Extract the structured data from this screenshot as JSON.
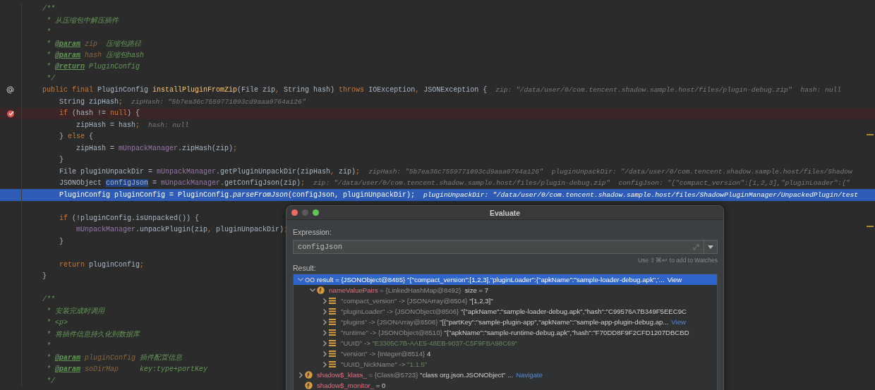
{
  "editor": {
    "lines": [
      {
        "kind": "code",
        "segments": [
          {
            "kind": "doc",
            "text": "/**"
          }
        ]
      },
      {
        "kind": "code",
        "segments": [
          {
            "kind": "doc",
            "text": " * 从压缩包中解压插件"
          }
        ]
      },
      {
        "kind": "code",
        "segments": [
          {
            "kind": "doc",
            "text": " *"
          }
        ]
      },
      {
        "kind": "code",
        "segments": [
          {
            "kind": "doc",
            "text": " * "
          },
          {
            "kind": "tag",
            "text": "@param"
          },
          {
            "kind": "param",
            "text": " zip"
          },
          {
            "kind": "doc",
            "text": "  压缩包路径"
          }
        ]
      },
      {
        "kind": "code",
        "segments": [
          {
            "kind": "doc",
            "text": " * "
          },
          {
            "kind": "tag",
            "text": "@param"
          },
          {
            "kind": "param",
            "text": " hash"
          },
          {
            "kind": "doc",
            "text": " 压缩包hash"
          }
        ]
      },
      {
        "kind": "code",
        "segments": [
          {
            "kind": "doc",
            "text": " * "
          },
          {
            "kind": "tag",
            "text": "@return"
          },
          {
            "kind": "doc",
            "text": " PluginConfig"
          }
        ]
      },
      {
        "kind": "code",
        "segments": [
          {
            "kind": "doc",
            "text": " */"
          }
        ]
      },
      {
        "kind": "marked",
        "segments": [
          {
            "kind": "kw",
            "text": "public final "
          },
          {
            "kind": "plain",
            "text": "PluginConfig "
          },
          {
            "kind": "decl",
            "text": "installPluginFromZip"
          },
          {
            "kind": "plain",
            "text": "(File zip"
          },
          {
            "kind": "kw",
            "text": ", "
          },
          {
            "kind": "plain",
            "text": "String hash) "
          },
          {
            "kind": "kw",
            "text": "throws "
          },
          {
            "kind": "plain",
            "text": "IOException"
          },
          {
            "kind": "kw",
            "text": ", "
          },
          {
            "kind": "plain",
            "text": "JSONException {"
          }
        ],
        "hints": [
          "zip: \"/data/user/0/com.tencent.shadow.sample.host/files/plugin-debug.zip\"",
          "hash: null"
        ]
      },
      {
        "kind": "code",
        "segments": [
          {
            "kind": "plain",
            "text": "    String zipHash"
          },
          {
            "kind": "kw",
            "text": ";"
          }
        ],
        "hints": [
          "zipHash: \"5b7ea36c7559771093cd9aaa0764a126\""
        ]
      },
      {
        "kind": "breakpoint",
        "segments": [
          {
            "kind": "kw",
            "text": "    if "
          },
          {
            "kind": "plain",
            "text": "(hash != "
          },
          {
            "kind": "kw",
            "text": "null"
          },
          {
            "kind": "plain",
            "text": ") {"
          }
        ]
      },
      {
        "kind": "code",
        "segments": [
          {
            "kind": "plain",
            "text": "        zipHash = hash"
          },
          {
            "kind": "kw",
            "text": ";"
          }
        ],
        "hints": [
          "hash: null"
        ]
      },
      {
        "kind": "code",
        "segments": [
          {
            "kind": "plain",
            "text": "    } "
          },
          {
            "kind": "kw",
            "text": "else "
          },
          {
            "kind": "plain",
            "text": "{"
          }
        ]
      },
      {
        "kind": "code",
        "segments": [
          {
            "kind": "plain",
            "text": "        zipHash = "
          },
          {
            "kind": "field",
            "text": "mUnpackManager"
          },
          {
            "kind": "plain",
            "text": ".zipHash(zip)"
          },
          {
            "kind": "kw",
            "text": ";"
          }
        ]
      },
      {
        "kind": "code",
        "segments": [
          {
            "kind": "plain",
            "text": "    }"
          }
        ]
      },
      {
        "kind": "code",
        "segments": [
          {
            "kind": "plain",
            "text": "    File pluginUnpackDir = "
          },
          {
            "kind": "field",
            "text": "mUnpackManager"
          },
          {
            "kind": "plain",
            "text": ".getPluginUnpackDir(zipHash"
          },
          {
            "kind": "kw",
            "text": ", "
          },
          {
            "kind": "plain",
            "text": "zip)"
          },
          {
            "kind": "kw",
            "text": ";"
          }
        ],
        "hints": [
          "zipHash: \"5b7ea36c7559771093cd9aaa0764a126\"",
          "pluginUnpackDir: \"/data/user/0/com.tencent.shadow.sample.host/files/Shadow"
        ]
      },
      {
        "kind": "code",
        "segments": [
          {
            "kind": "plain",
            "text": "    JSONObject "
          },
          {
            "kind": "sel",
            "text": "configJson"
          },
          {
            "kind": "plain",
            "text": " = "
          },
          {
            "kind": "field",
            "text": "mUnpackManager"
          },
          {
            "kind": "plain",
            "text": ".getConfigJson(zip)"
          },
          {
            "kind": "kw",
            "text": ";"
          }
        ],
        "hints": [
          "zip: \"/data/user/0/com.tencent.shadow.sample.host/files/plugin-debug.zip\"",
          "configJson: \"{\"compact_version\":[1,2,3],\"pluginLoader\":{\""
        ]
      },
      {
        "kind": "execution",
        "segments": [
          {
            "kind": "plain",
            "text": "    PluginConfig pluginConfig = PluginConfig."
          },
          {
            "kind": "static",
            "text": "parseFromJson"
          },
          {
            "kind": "plain",
            "text": "(configJson, pluginUnpackDir);"
          }
        ],
        "hints": [
          "pluginUnpackDir: \"/data/user/0/com.tencent.shadow.sample.host/files/ShadowPluginManager/UnpackedPlugin/test"
        ]
      },
      {
        "kind": "blank"
      },
      {
        "kind": "code",
        "segments": [
          {
            "kind": "kw",
            "text": "    if "
          },
          {
            "kind": "plain",
            "text": "(!pluginConfig.isUnpacked()) {"
          }
        ]
      },
      {
        "kind": "code",
        "segments": [
          {
            "kind": "field",
            "text": "        mUnpackManager"
          },
          {
            "kind": "plain",
            "text": ".unpackPlugin(zip"
          },
          {
            "kind": "kw",
            "text": ", "
          },
          {
            "kind": "plain",
            "text": "pluginUnpackDir)"
          },
          {
            "kind": "kw",
            "text": ";"
          }
        ]
      },
      {
        "kind": "code",
        "segments": [
          {
            "kind": "plain",
            "text": "    }"
          }
        ]
      },
      {
        "kind": "blank"
      },
      {
        "kind": "code",
        "segments": [
          {
            "kind": "kw",
            "text": "    return "
          },
          {
            "kind": "plain",
            "text": "pluginConfig"
          },
          {
            "kind": "kw",
            "text": ";"
          }
        ]
      },
      {
        "kind": "code",
        "segments": [
          {
            "kind": "plain",
            "text": "}"
          }
        ]
      },
      {
        "kind": "blank"
      },
      {
        "kind": "code",
        "segments": [
          {
            "kind": "doc",
            "text": "/**"
          }
        ]
      },
      {
        "kind": "code",
        "segments": [
          {
            "kind": "doc",
            "text": " * 安装完成时调用"
          }
        ]
      },
      {
        "kind": "code",
        "segments": [
          {
            "kind": "doc",
            "text": " * <p>"
          }
        ]
      },
      {
        "kind": "code",
        "segments": [
          {
            "kind": "doc",
            "text": " * 将插件信息持久化到数据库"
          }
        ]
      },
      {
        "kind": "code",
        "segments": [
          {
            "kind": "doc",
            "text": " *"
          }
        ]
      },
      {
        "kind": "code",
        "segments": [
          {
            "kind": "doc",
            "text": " * "
          },
          {
            "kind": "tag",
            "text": "@param"
          },
          {
            "kind": "param",
            "text": " pluginConfig"
          },
          {
            "kind": "doc",
            "text": " 插件配置信息"
          }
        ]
      },
      {
        "kind": "code",
        "segments": [
          {
            "kind": "doc",
            "text": " * "
          },
          {
            "kind": "tag",
            "text": "@param"
          },
          {
            "kind": "param",
            "text": " soDirMap"
          },
          {
            "kind": "doc",
            "text": "     key:type+portKey"
          }
        ]
      },
      {
        "kind": "code",
        "segments": [
          {
            "kind": "doc",
            "text": " */"
          }
        ]
      }
    ]
  },
  "evaluate_dialog": {
    "title": "Evaluate",
    "expression_label": "Expression:",
    "expression": "configJson",
    "shortcut_hint": "Use ⇧⌘↩ to add to Watches",
    "result_label": "Result:",
    "tree": [
      {
        "kind": "watch",
        "expanded": true,
        "selected": true,
        "segments": [
          {
            "kind": "var",
            "text": "result"
          },
          {
            "kind": "type",
            "text": " = {JSONObject@8485} "
          },
          {
            "kind": "value",
            "text": "\"{\"compact_version\":[1,2,3],\"pluginLoader\":{\"apkName\":\"sample-loader-debug.apk\",'..."
          }
        ],
        "link": "View",
        "children": [
          {
            "kind": "field",
            "expanded": true,
            "selected": false,
            "segments": [
              {
                "kind": "field",
                "text": "nameValuePairs"
              },
              {
                "kind": "type",
                "text": " = {LinkedHashMap@8492}  "
              },
              {
                "kind": "value",
                "text": "size = 7"
              }
            ],
            "children": [
              {
                "kind": "entry",
                "expanded": false,
                "selected": false,
                "segments": [
                  {
                    "kind": "key",
                    "text": "\"compact_version\""
                  },
                  {
                    "kind": "type",
                    "text": " -> {JSONArray@8504} "
                  },
                  {
                    "kind": "value",
                    "text": "\"[1,2,3]\""
                  }
                ]
              },
              {
                "kind": "entry",
                "expanded": false,
                "selected": false,
                "segments": [
                  {
                    "kind": "key",
                    "text": "\"pluginLoader\""
                  },
                  {
                    "kind": "type",
                    "text": " -> {JSONObject@8506} "
                  },
                  {
                    "kind": "value",
                    "text": "\"{\"apkName\":\"sample-loader-debug.apk\",\"hash\":\"C99576A7B349F5EEC9C"
                  }
                ]
              },
              {
                "kind": "entry",
                "expanded": false,
                "selected": false,
                "segments": [
                  {
                    "kind": "key",
                    "text": "\"plugins\""
                  },
                  {
                    "kind": "type",
                    "text": " -> {JSONArray@8508} "
                  },
                  {
                    "kind": "value",
                    "text": "\"[{\"partKey\":\"sample-plugin-app\",\"apkName\":\"sample-app-plugin-debug.ap..."
                  }
                ],
                "link": "View"
              },
              {
                "kind": "entry",
                "expanded": false,
                "selected": false,
                "segments": [
                  {
                    "kind": "key",
                    "text": "\"runtime\""
                  },
                  {
                    "kind": "type",
                    "text": " -> {JSONObject@8510} "
                  },
                  {
                    "kind": "value",
                    "text": "\"{\"apkName\":\"sample-runtime-debug.apk\",\"hash\":\"F70DD8F9F2CFD1207DBCBD"
                  }
                ]
              },
              {
                "kind": "entry",
                "expanded": false,
                "selected": false,
                "segments": [
                  {
                    "kind": "key",
                    "text": "\"UUID\""
                  },
                  {
                    "kind": "type",
                    "text": " -> "
                  },
                  {
                    "kind": "string",
                    "text": "\"E3305C7B-AAE5-48EB-9037-C5F9FBA98C69\""
                  }
                ]
              },
              {
                "kind": "entry",
                "expanded": false,
                "selected": false,
                "segments": [
                  {
                    "kind": "key",
                    "text": "\"version\""
                  },
                  {
                    "kind": "type",
                    "text": " -> {Integer@8514} "
                  },
                  {
                    "kind": "value",
                    "text": "4"
                  }
                ]
              },
              {
                "kind": "entry",
                "expanded": false,
                "selected": false,
                "segments": [
                  {
                    "kind": "key",
                    "text": "\"UUID_NickName\""
                  },
                  {
                    "kind": "type",
                    "text": " -> "
                  },
                  {
                    "kind": "string",
                    "text": "\"1.1.5\""
                  }
                ]
              }
            ]
          }
        ]
      },
      {
        "kind": "field",
        "expanded": false,
        "selected": false,
        "segments": [
          {
            "kind": "field",
            "text": "shadow$_klass_"
          },
          {
            "kind": "type",
            "text": " = {Class@5723} "
          },
          {
            "kind": "value",
            "text": "\"class org.json.JSONObject\" ..."
          }
        ],
        "link": "Navigate"
      },
      {
        "kind": "field",
        "selected": false,
        "segments": [
          {
            "kind": "field",
            "text": "shadow$_monitor_"
          },
          {
            "kind": "value",
            "text": " = 0"
          }
        ]
      }
    ]
  }
}
